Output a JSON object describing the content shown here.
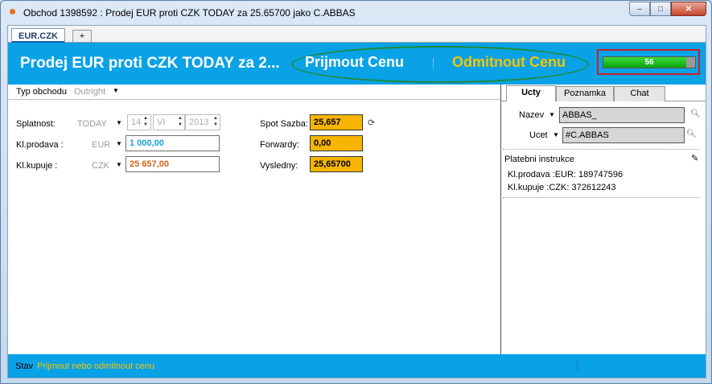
{
  "window": {
    "title": "Obchod 1398592 : Prodej EUR proti CZK TODAY za 25.65700 jako C.ABBAS",
    "buttons": {
      "minimize": "–",
      "maximize": "□",
      "close": "✕"
    }
  },
  "tabs": {
    "active": "EUR.CZK",
    "add": "+"
  },
  "header": {
    "title": "Prodej EUR proti CZK TODAY za 2...",
    "accept_label": "Prijmout Cenu",
    "reject_label": "Odmitnout Cenu",
    "timer_value": "56",
    "timer_fill_fraction": 0.9,
    "highlight_color": "#1e8a37",
    "timer_border_color": "#c8202a"
  },
  "trade": {
    "type_label": "Typ obchodu",
    "type_value": "Outright",
    "maturity_label": "Splatnost:",
    "maturity_value": "TODAY",
    "day": "14",
    "month": "VI",
    "year": "2013",
    "sell_label": "Kl.prodava :",
    "sell_currency": "EUR",
    "sell_amount": "1 000,00",
    "buy_label": "Kl.kupuje :",
    "buy_currency": "CZK",
    "buy_amount": "25 657,00",
    "spot_label": "Spot Sazba:",
    "spot_value": "25,657",
    "forward_label": "Forwardy:",
    "forward_value": "0,00",
    "result_label": "Vysledny:",
    "result_value": "25,65700",
    "sell_color": "#1aa0d8",
    "buy_color": "#d8641a"
  },
  "side": {
    "tabs": [
      "Ucty",
      "Poznamka",
      "Chat"
    ],
    "name_label": "Nazev",
    "name_value": "ABBAS_",
    "account_label": "Ucet",
    "account_value": "#C.ABBAS",
    "payment_title": "Platebni instrukce",
    "payment_sell": "Kl.prodava :EUR: 189747596",
    "payment_buy": "Kl.kupuje :CZK: 372612243"
  },
  "status": {
    "label": "Stav",
    "value": "Prijmout nebo odmitnout cenu"
  },
  "icons": {
    "refresh": "refresh-icon",
    "search": "magnifier-icon",
    "edit": "pencil-icon"
  }
}
